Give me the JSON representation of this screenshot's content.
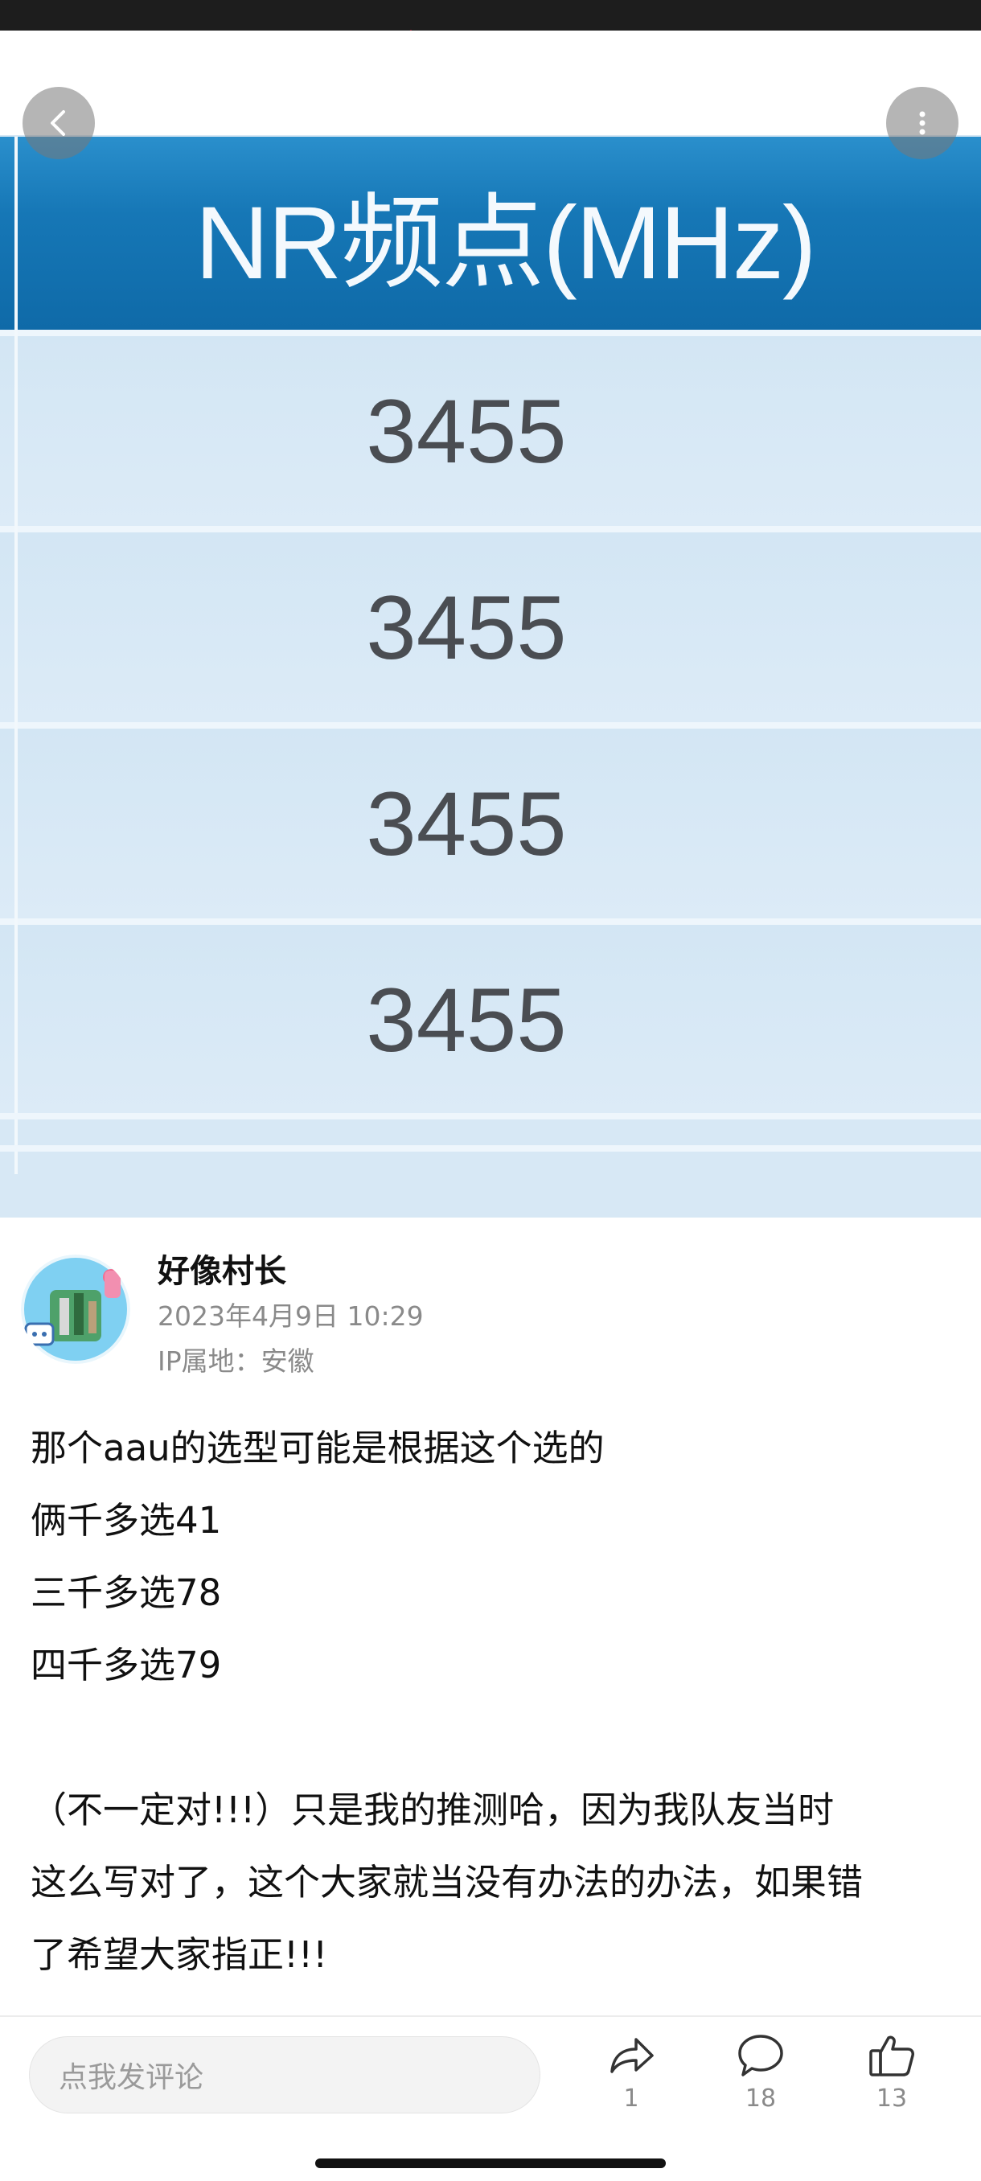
{
  "post_image": {
    "header": "NR频点(MHz)",
    "rows": [
      "3455",
      "3455",
      "3455",
      "3455"
    ]
  },
  "author": {
    "name": "好像村长",
    "time": "2023年4月9日 10:29",
    "ip": "IP属地：安徽"
  },
  "post": {
    "lines": [
      "那个aau的选型可能是根据这个选的",
      "俩千多选41",
      "三千多选78",
      "四千多选79",
      "",
      "（不一定对!!!）只是我的推测哈，因为我队友当时",
      "这么写对了，这个大家就当没有办法的办法，如果错",
      "了希望大家指正!!!"
    ]
  },
  "bottom_bar": {
    "comment_placeholder": "点我发评论",
    "share_count": "1",
    "comment_count": "18",
    "like_count": "13"
  },
  "colors": {
    "table_header": "#1677b6",
    "table_cell": "#d7e8f5",
    "accent_icon": "#c8102e"
  }
}
